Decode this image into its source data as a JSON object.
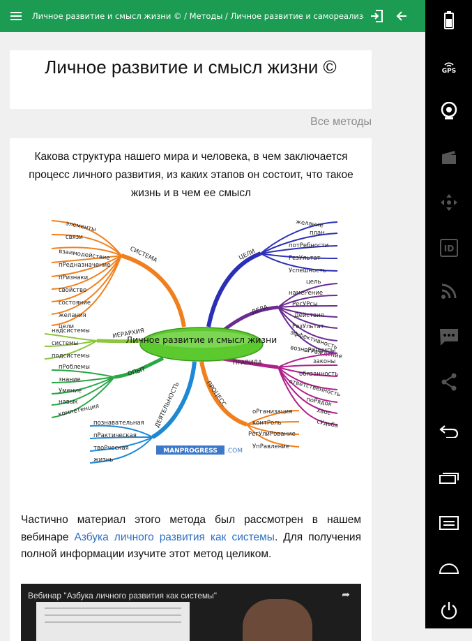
{
  "topbar": {
    "breadcrumb": "Личное развитие и смысл жизни © / Методы / Личное развитие и самореализация",
    "menu_icon": "hamburger-menu-icon",
    "login_icon": "login-icon",
    "back_icon": "arrow-back-icon",
    "color": "#1b9c52"
  },
  "page": {
    "title": "Личное развитие и смысл жизни ©",
    "all_methods_link": "Все методы",
    "subtitle": "Какова структура нашего мира и человека, в чем заключается процесс личного развития, из каких этапов он состоит, что такое жизнь и в чем ее смысл"
  },
  "mindmap": {
    "center": "Личное развитие и смысл жизни",
    "watermark": "MANPROGRESS",
    "watermark_suffix": ".COM",
    "branches": {
      "system": {
        "label": "СИСТЕМА",
        "color": "#f0801e",
        "items": [
          "элементы",
          "связи",
          "взаимодействие",
          "пРедназначение",
          "пРизнаки",
          "свойство",
          "состояние",
          "желания",
          "цели"
        ]
      },
      "hierarchy": {
        "label": "ИЕРАРХИЯ",
        "color": "#8cc63f",
        "items": [
          "надсистемы",
          "системы",
          "подсистемы"
        ]
      },
      "experience": {
        "label": "ОПЫТ",
        "color": "#28a745",
        "items": [
          "пРоблемы",
          "знание",
          "Умение",
          "навык",
          "компетенция"
        ]
      },
      "activity": {
        "label": "ДЕЯТЕЛЬНОСТЬ",
        "color": "#1e88d4",
        "items": [
          "познавательная",
          "пРактическая",
          "твоРческая",
          "жизнь"
        ]
      },
      "goals": {
        "label": "ЦЕЛИ",
        "color": "#2b2fb5",
        "items": [
          "желание",
          "план",
          "потРебности",
          "РезУльтат",
          "Успешность"
        ]
      },
      "affairs": {
        "label": "ДЕЛА",
        "color": "#6a2c91",
        "items": [
          "цель",
          "намеРение",
          "РесУРсы",
          "Действия",
          "РезУльтат",
          "эффективность",
          "вознагРаждение"
        ]
      },
      "rules": {
        "label": "ПРАВИЛА",
        "color": "#b0208c",
        "items": [
          "пРинципы",
          "законы",
          "обязанность",
          "ответственность",
          "поРядок",
          "хаос",
          "сУдьба"
        ]
      },
      "process": {
        "label": "ПРОЦЕСС",
        "color": "#f0801e",
        "items": [
          "оРганизация",
          "контРоль",
          "РегУлиРование",
          "УпРавление"
        ]
      }
    }
  },
  "article": {
    "paragraph_before": "Частично материал этого метода был рассмотрен в нашем вебинаре",
    "link_text": "Азбука личного развития как системы",
    "paragraph_after": ". Для получения полной информации изучите этот метод целиком."
  },
  "video": {
    "title": "Вебинар \"Азбука личного развития как системы\"",
    "share_icon": "share-arrow-icon"
  },
  "system_bar": {
    "icons": [
      "battery-icon",
      "gps-icon",
      "webcam-icon",
      "clapper-icon",
      "dpad-icon",
      "id-card-icon",
      "rss-icon",
      "chat-icon",
      "share-icon",
      "back-icon",
      "recent-apps-icon",
      "menu-icon",
      "home-icon",
      "power-icon"
    ],
    "gps_label": "GPS",
    "id_label": "ID"
  }
}
